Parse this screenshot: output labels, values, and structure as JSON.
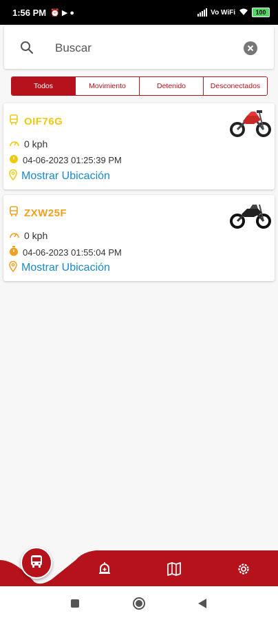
{
  "status_bar": {
    "time": "1:56 PM",
    "network": "Vo WiFi",
    "battery": "100"
  },
  "search": {
    "placeholder": "Buscar",
    "value": ""
  },
  "filters": {
    "tabs": [
      "Todos",
      "Movimiento",
      "Detenido",
      "Desconectados"
    ],
    "active_index": 0
  },
  "vehicles": [
    {
      "plate": "OIF76G",
      "plate_color": "#f2c80f",
      "speed": "0 kph",
      "timestamp": "04-06-2023 01:25:39 PM",
      "time_icon_color": "#f2c80f",
      "location_label": "Mostrar Ubicación",
      "moto_color": "red-black-motorcycle"
    },
    {
      "plate": "ZXW25F",
      "plate_color": "#f0a020",
      "speed": "0 kph",
      "timestamp": "04-06-2023 01:55:04 PM",
      "time_icon_color": "#f0a020",
      "location_label": "Mostrar Ubicación",
      "moto_color": "black-motorcycle"
    }
  ],
  "bottom_nav": {
    "items": [
      "bus-icon",
      "alarm-bell-icon",
      "map-icon",
      "gear-icon"
    ],
    "accent": "#b5121b"
  },
  "colors": {
    "primary": "#b5121b",
    "link": "#1a88c9"
  }
}
